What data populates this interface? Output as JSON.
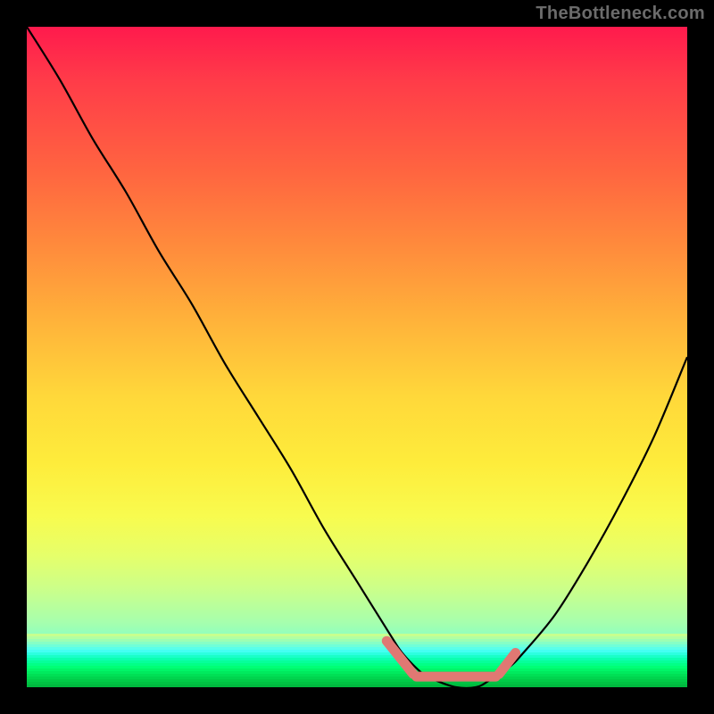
{
  "watermark": "TheBottleneck.com",
  "colors": {
    "frame": "#000000",
    "curve": "#000000",
    "highlight": "#e07873",
    "watermark": "#6b6b6b"
  },
  "chart_data": {
    "type": "line",
    "title": "",
    "xlabel": "",
    "ylabel": "",
    "xlim": [
      0,
      100
    ],
    "ylim": [
      0,
      100
    ],
    "grid": false,
    "legend": false,
    "x": [
      0,
      5,
      10,
      15,
      20,
      25,
      30,
      35,
      40,
      45,
      50,
      55,
      57,
      60,
      62,
      65,
      68,
      70,
      73,
      75,
      80,
      85,
      90,
      95,
      100
    ],
    "values": [
      100,
      92,
      83,
      75,
      66,
      58,
      49,
      41,
      33,
      24,
      16,
      8,
      5,
      2,
      1,
      0,
      0,
      1,
      3,
      5,
      11,
      19,
      28,
      38,
      50
    ],
    "annotations": [
      {
        "label": "bottleneck-minimum-band",
        "x_start": 57,
        "x_end": 73
      }
    ],
    "highlight_segments": [
      {
        "x0": 54.5,
        "y0": 7.0,
        "x1": 58.5,
        "y1": 2.0
      },
      {
        "x0": 59.0,
        "y0": 1.6,
        "x1": 71.0,
        "y1": 1.6
      },
      {
        "x0": 71.5,
        "y0": 2.0,
        "x1": 74.0,
        "y1": 5.2
      }
    ]
  }
}
